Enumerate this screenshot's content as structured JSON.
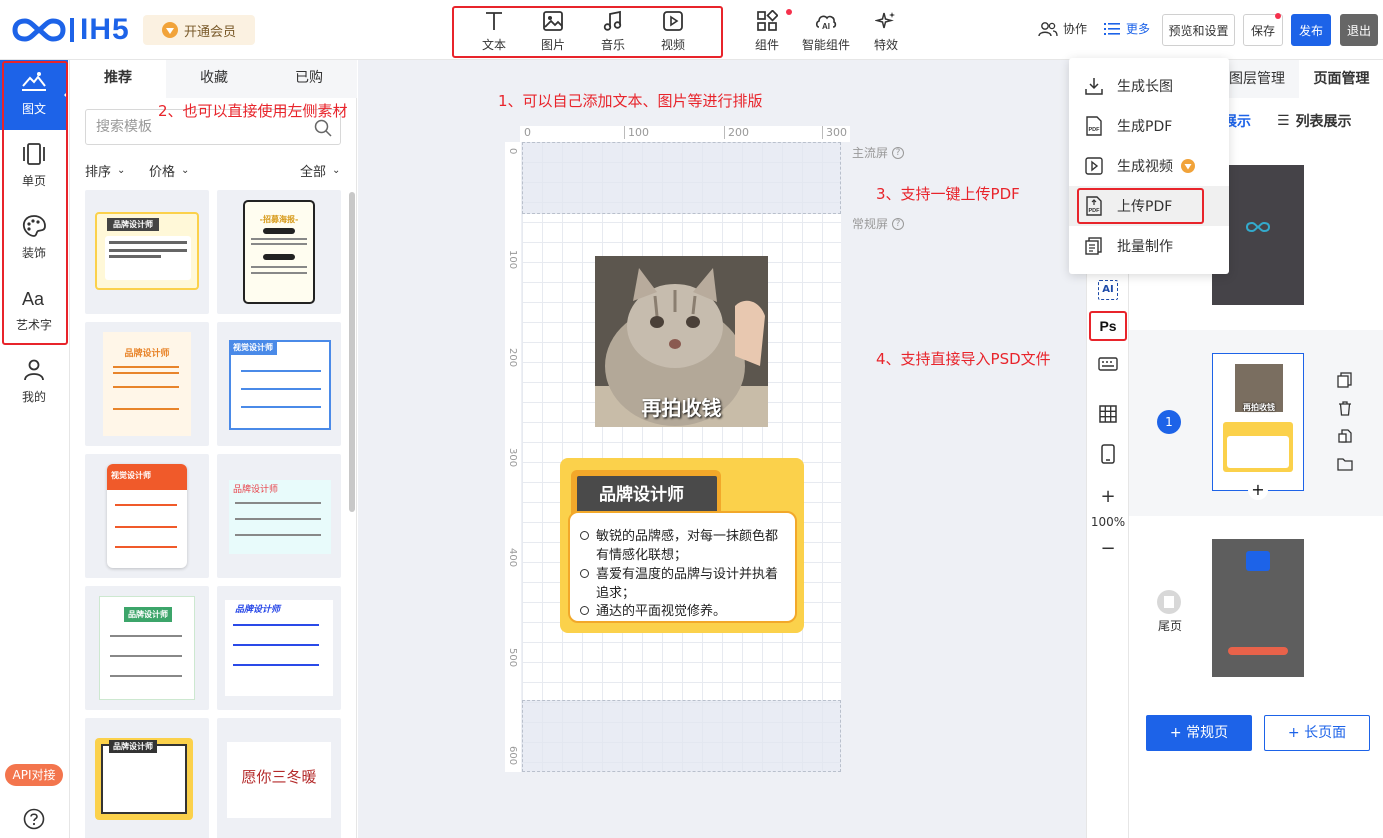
{
  "brand": {
    "logo_text": "IH5",
    "vip_label": "开通会员"
  },
  "toolbar": {
    "insert": [
      {
        "label": "文本",
        "icon": "text-icon"
      },
      {
        "label": "图片",
        "icon": "image-icon"
      },
      {
        "label": "音乐",
        "icon": "music-icon"
      },
      {
        "label": "视频",
        "icon": "video-icon"
      }
    ],
    "component_label": "组件",
    "smart_label": "智能组件",
    "effects_label": "特效",
    "collab_label": "协作",
    "more_label": "更多",
    "preview_label": "预览和设置",
    "save_label": "保存",
    "publish_label": "发布",
    "exit_label": "退出"
  },
  "sidebar": {
    "items": [
      {
        "label": "图文",
        "icon": "image-text-icon"
      },
      {
        "label": "单页",
        "icon": "single-page-icon"
      },
      {
        "label": "装饰",
        "icon": "palette-icon"
      },
      {
        "label": "艺术字",
        "icon": "art-text-icon"
      },
      {
        "label": "我的",
        "icon": "user-icon"
      }
    ],
    "api_label": "API对接",
    "help_icon": "help-icon"
  },
  "panel": {
    "tabs": [
      "推荐",
      "收藏",
      "已购"
    ],
    "search_placeholder": "搜索模板",
    "filters": {
      "sort": "排序",
      "price": "价格",
      "all": "全部"
    },
    "templates": [
      {
        "title": "品牌设计师"
      },
      {
        "title": "-招募海报-"
      },
      {
        "title": "品牌设计师"
      },
      {
        "title": "视觉设计师"
      },
      {
        "title": "视觉设计师"
      },
      {
        "title": "品牌设计师"
      },
      {
        "title": "品牌设计师"
      },
      {
        "title": "品牌设计师"
      },
      {
        "title": "品牌设计师"
      },
      {
        "title": "愿你三冬暖"
      }
    ]
  },
  "canvas": {
    "ruler_x": [
      "0",
      "100",
      "200",
      "300"
    ],
    "ruler_y": [
      "0",
      "100",
      "200",
      "300",
      "400",
      "500",
      "600"
    ],
    "main_screen_label": "主流屏",
    "normal_screen_label": "常规屏",
    "cat_caption": "再拍收钱",
    "card_title": "品牌设计师",
    "card_lines": [
      "敏锐的品牌感，对每一抹颜色都有情感化联想；",
      "喜爱有温度的品牌与设计并执着追求；",
      "通达的平面视觉修养。"
    ]
  },
  "annotations": {
    "a1": "1、可以自己添加文本、图片等进行排版",
    "a2": "2、也可以直接使用左侧素材",
    "a3": "3、支持一键上传PDF",
    "a4": "4、支持直接导入PSD文件"
  },
  "dropdown": {
    "items": [
      {
        "label": "生成长图"
      },
      {
        "label": "生成PDF"
      },
      {
        "label": "生成视频"
      },
      {
        "label": "上传PDF"
      },
      {
        "label": "批量制作"
      }
    ]
  },
  "right_tools": {
    "ai_label": "AI",
    "ps_label": "Ps",
    "zoom_in": "+",
    "zoom": "100%",
    "zoom_out": "−"
  },
  "pages_panel": {
    "tab_layers": "图层管理",
    "tab_pages": "页面管理",
    "view_show": "展示",
    "view_list": "列表展示",
    "page_num": "1",
    "page_thumb_caption": "再拍收钱",
    "end_label": "尾页",
    "btn_normal": "+ 常规页",
    "btn_long": "+ 长页面"
  },
  "colors": {
    "accent": "#1d63e8",
    "annotation": "#e8242b",
    "card_yellow": "#fbd14b"
  }
}
